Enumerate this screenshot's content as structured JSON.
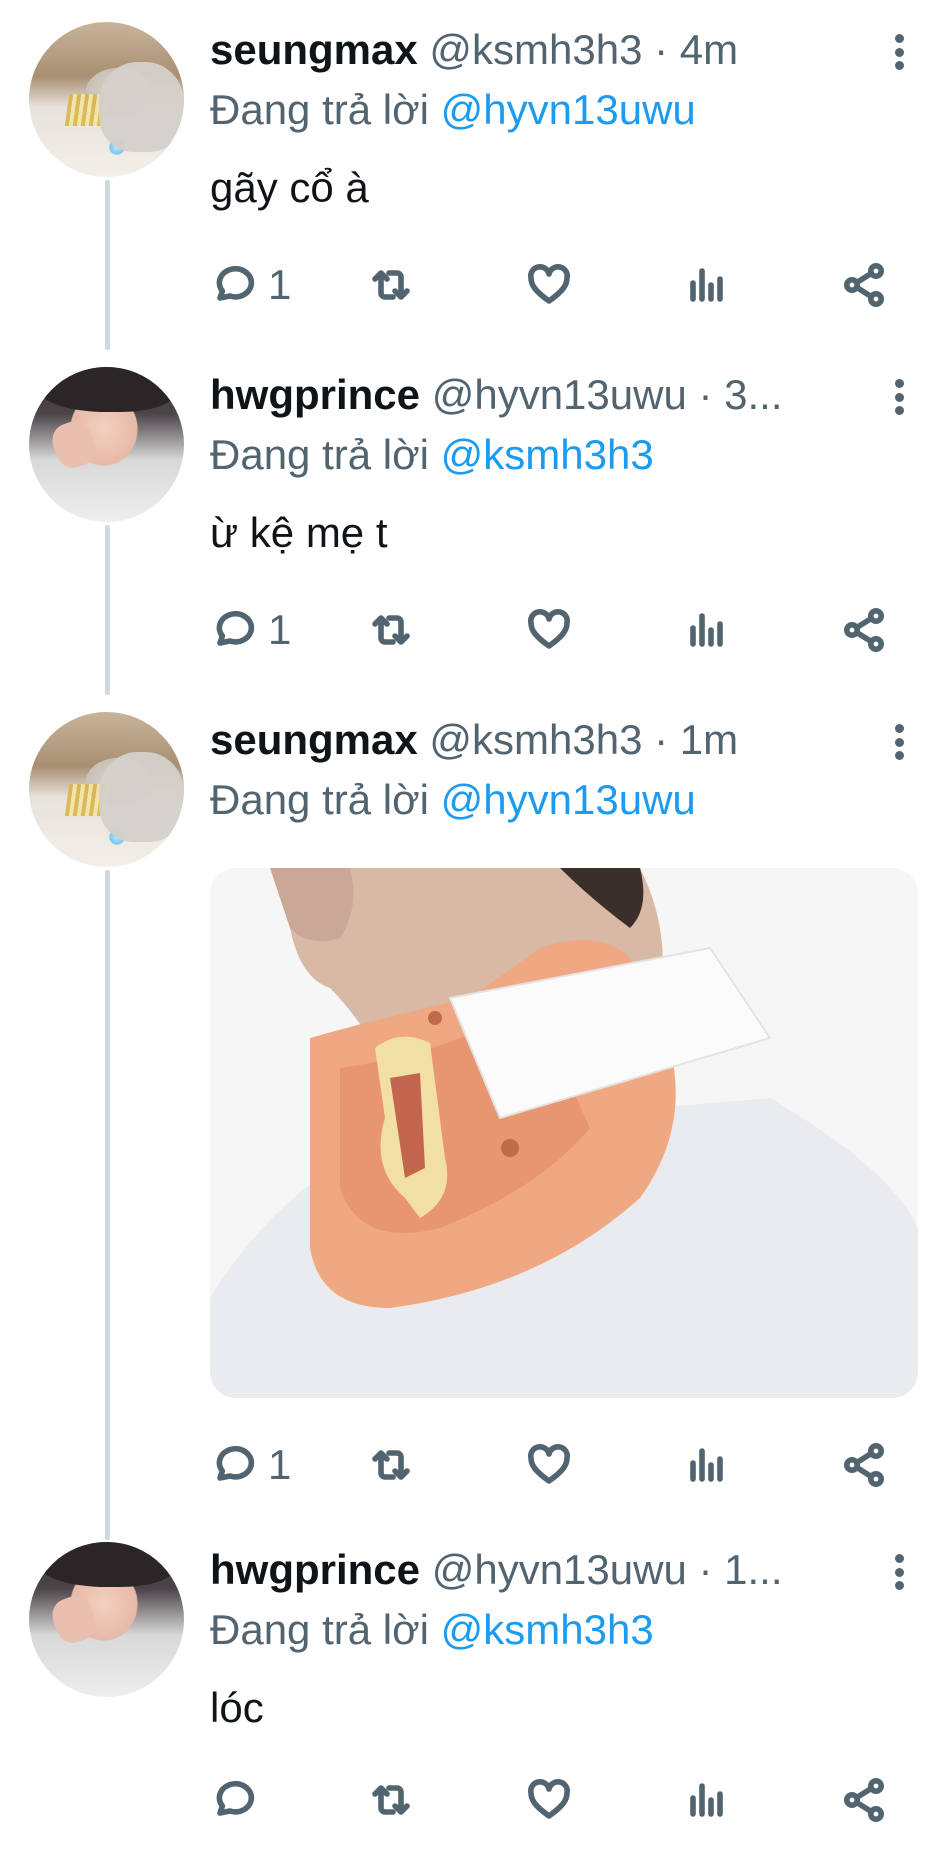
{
  "tweets": [
    {
      "name": "seungmax",
      "handle": "@ksmh3h3 · 4m",
      "reply_prefix": "Đang trả lời ",
      "reply_to": "@hyvn13uwu",
      "text": "gãy cổ à",
      "reply_count": "1"
    },
    {
      "name": "hwgprince",
      "handle": "@hyvn13uwu · 3...",
      "reply_prefix": "Đang trả lời ",
      "reply_to": "@ksmh3h3",
      "text": "ừ kệ mẹ t",
      "reply_count": "1"
    },
    {
      "name": "seungmax",
      "handle": "@ksmh3h3 · 1m",
      "reply_prefix": "Đang trả lời ",
      "reply_to": "@hyvn13uwu",
      "text": "",
      "reply_count": "1",
      "media": "photo of a man wearing an orange cervical neck brace"
    },
    {
      "name": "hwgprince",
      "handle": "@hyvn13uwu · 1...",
      "reply_prefix": "Đang trả lời ",
      "reply_to": "@ksmh3h3",
      "text": "lóc",
      "reply_count": ""
    }
  ],
  "icons": {
    "reply": "reply-icon",
    "retweet": "retweet-icon",
    "like": "heart-icon",
    "analytics": "analytics-icon",
    "share": "share-icon",
    "more": "more-icon"
  },
  "colors": {
    "mention": "#1d9bf0",
    "secondary_text": "#536471",
    "thread_line": "#cfd9de"
  }
}
